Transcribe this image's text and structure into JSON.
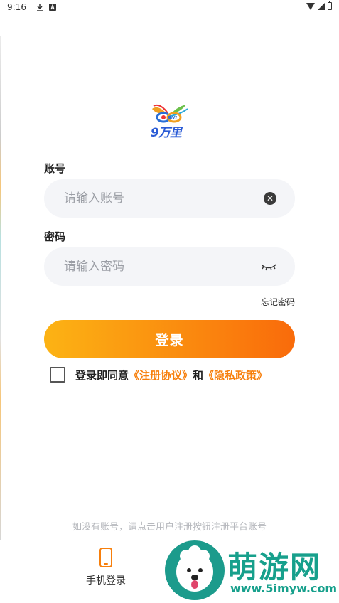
{
  "status_bar": {
    "time": "9:16"
  },
  "logo": {
    "text": "9万里",
    "sub_text": "JWL"
  },
  "account": {
    "label": "账号",
    "placeholder": "请输入账号",
    "value": ""
  },
  "password": {
    "label": "密码",
    "placeholder": "请输入密码",
    "value": ""
  },
  "forgot_password": "忘记密码",
  "login_button": "登录",
  "agreement": {
    "prefix": "登录即同意",
    "terms_link": "《注册协议》",
    "joiner": "和",
    "privacy_link": "《隐私政策》",
    "checked": false
  },
  "register_hint": "如没有账号，请点击用户注册按钮注册平台账号",
  "phone_login": {
    "label": "手机登录",
    "icon": "phone-icon"
  },
  "watermark": {
    "title": "萌游网",
    "url": "www.5imyw.com"
  },
  "colors": {
    "accent": "#f77f0c",
    "gradient_start": "#fcb314",
    "gradient_end": "#f96b0b",
    "input_bg": "#f4f5f8",
    "watermark": "#17a08c"
  }
}
